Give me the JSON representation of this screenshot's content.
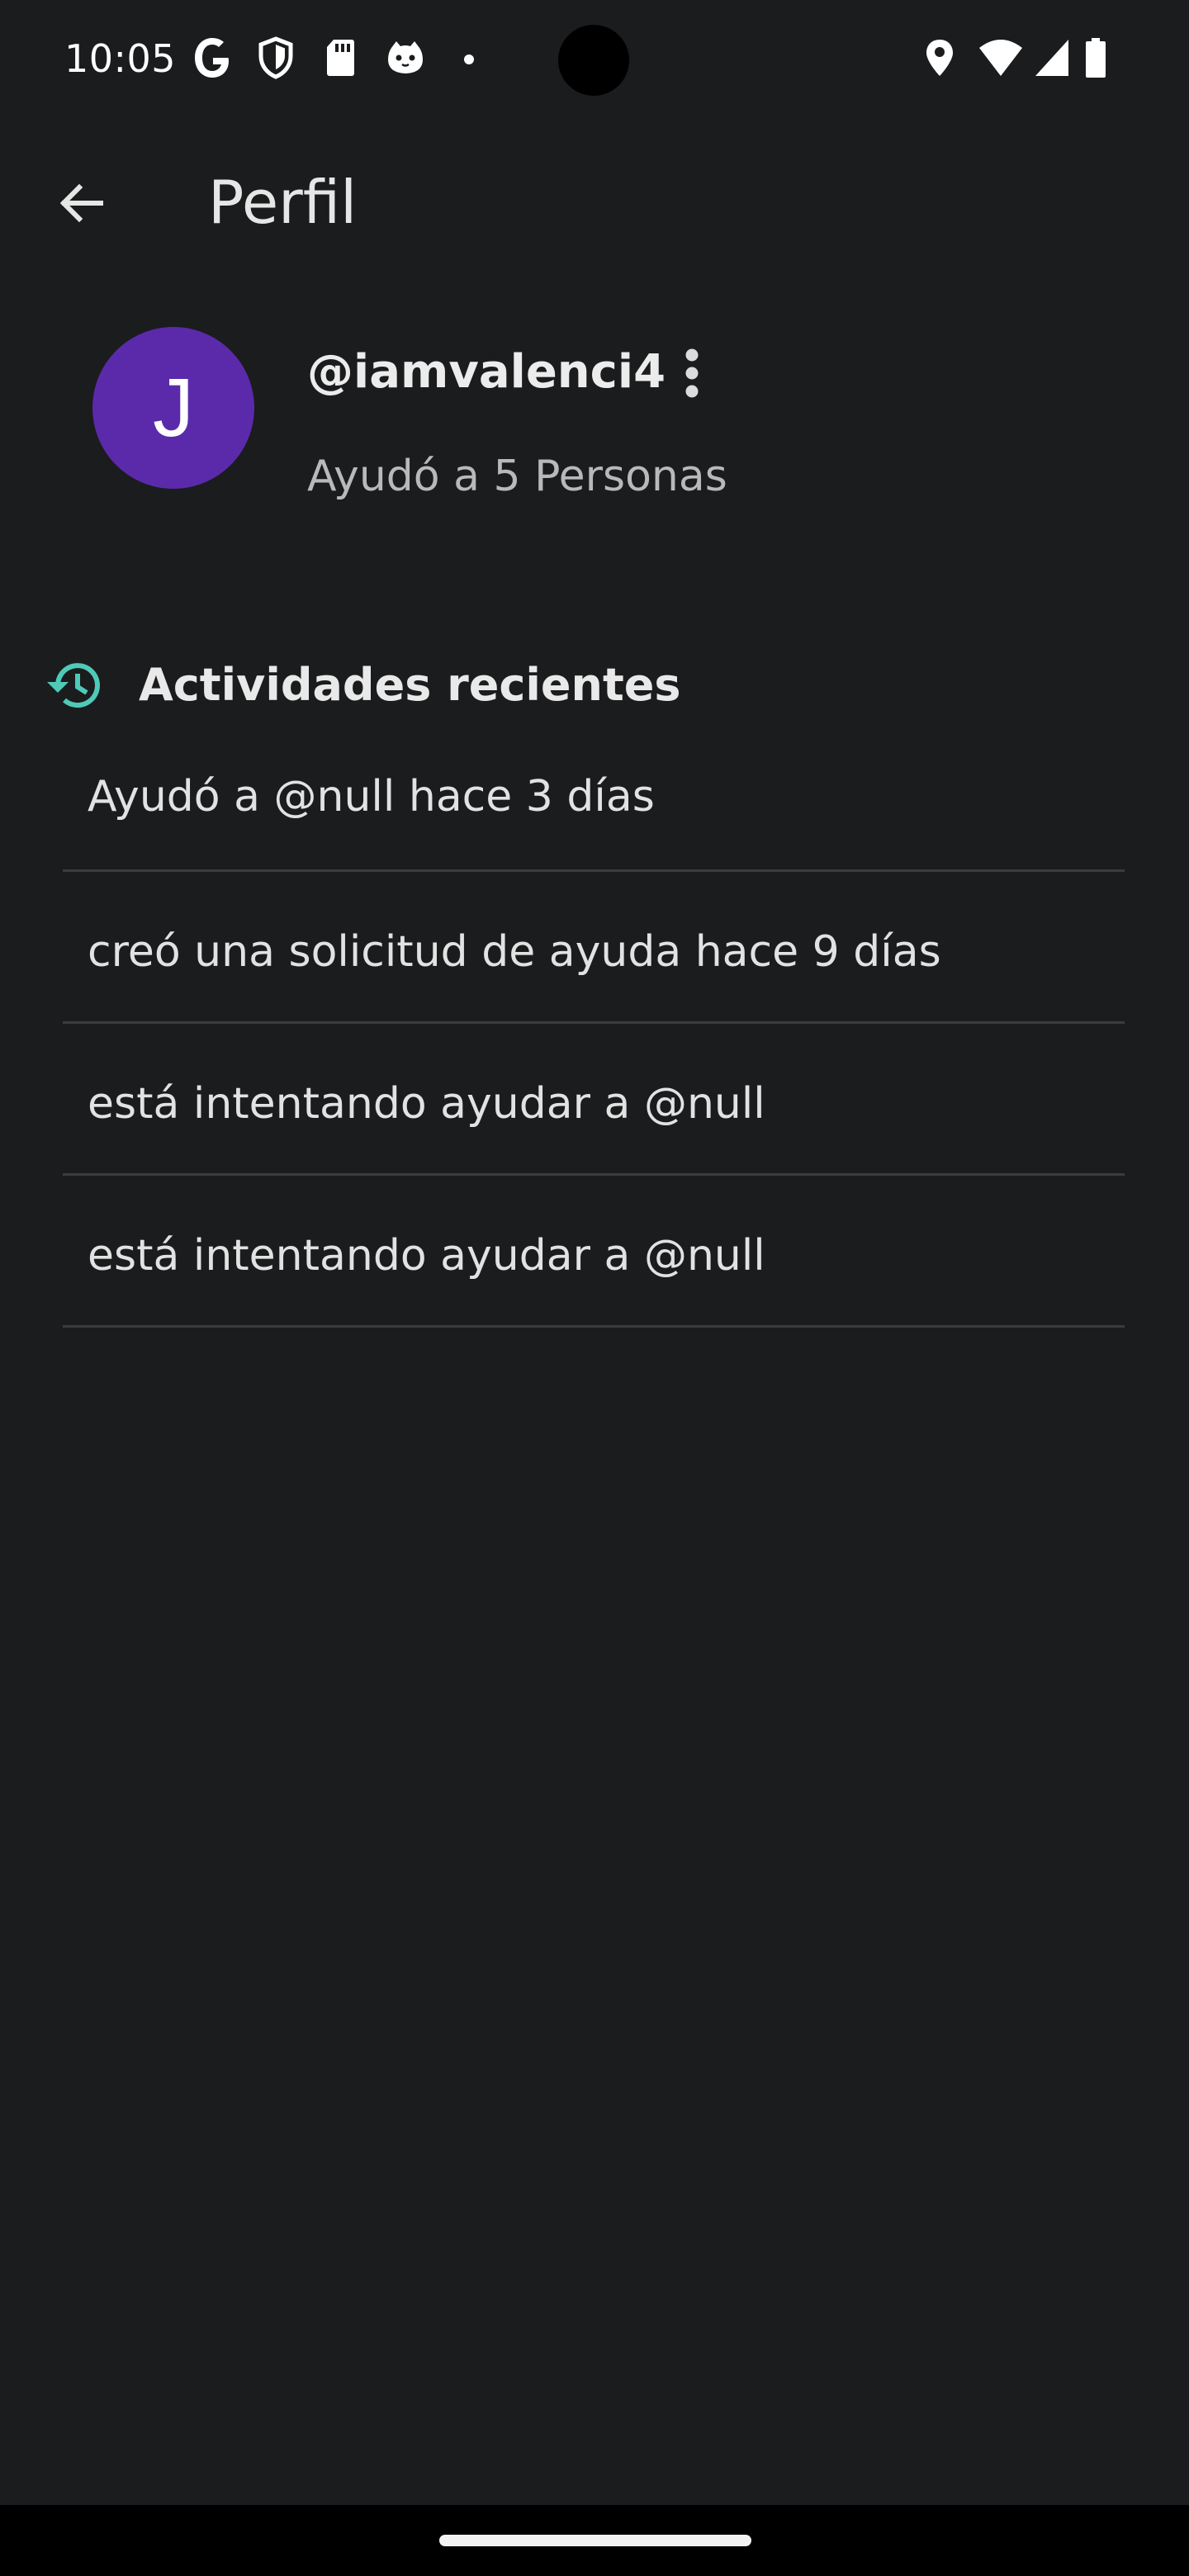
{
  "status_bar": {
    "time": "10:05",
    "left_icons": [
      "google-icon",
      "shield-icon",
      "sd-card-icon",
      "cat-icon",
      "dot-icon"
    ],
    "right_icons": [
      "location-icon",
      "wifi-icon",
      "signal-icon",
      "battery-icon"
    ]
  },
  "app_bar": {
    "title": "Perfil",
    "back_icon": "arrow-back-icon"
  },
  "profile": {
    "avatar_letter": "J",
    "avatar_color": "#5b2aab",
    "username": "@iamvalenci4",
    "helped": "Ayudó a 5 Personas",
    "more_icon": "more-vert-icon"
  },
  "recent": {
    "title": "Actividades recientes",
    "icon": "history-icon",
    "icon_color": "#4fc9b8",
    "items": [
      {
        "text": "Ayudó a @null hace 3 días"
      },
      {
        "text": "creó una solicitud de ayuda hace 9 días"
      },
      {
        "text": "está intentando ayudar a @null"
      },
      {
        "text": "está intentando ayudar a @null"
      }
    ]
  }
}
